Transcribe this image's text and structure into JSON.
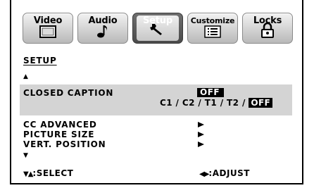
{
  "tabs": [
    {
      "label": "Video",
      "icon": "screen-icon",
      "active": false
    },
    {
      "label": "Audio",
      "icon": "music-note-icon",
      "active": false
    },
    {
      "label": "Setup",
      "icon": "wrench-icon",
      "active": true
    },
    {
      "label": "Customize",
      "icon": "list-icon",
      "active": false
    },
    {
      "label": "Locks",
      "icon": "padlock-icon",
      "active": false
    }
  ],
  "section_title": "SETUP",
  "scroll_up_glyph": "▲",
  "scroll_down_glyph": "▼",
  "closed_caption": {
    "label": "CLOSED CAPTION",
    "value": "OFF",
    "options_prefix": "C1 / C2 / T1 / T2 / ",
    "options_selected": "OFF"
  },
  "menu_items": [
    {
      "label": "CC ADVANCED"
    },
    {
      "label": "PICTURE SIZE"
    },
    {
      "label": "VERT. POSITION"
    }
  ],
  "footer": {
    "select_glyph": "▼▲",
    "select_label": ":SELECT",
    "adjust_glyph": "◀▶",
    "adjust_label": ":ADJUST"
  },
  "colors": {
    "highlight": "#d4d4d4",
    "active_tab": "#5a5a5a"
  }
}
